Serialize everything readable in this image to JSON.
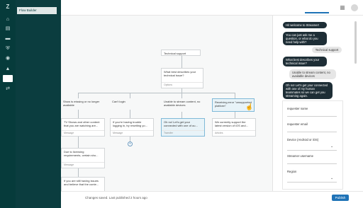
{
  "sidebar": {
    "title": "Flow Builder",
    "rail_icons": [
      "zendesk-logo-icon",
      "home-icon",
      "views-icon",
      "reporting-icon",
      "admin-icon",
      "bot-icon",
      "channels-icon",
      "flow-builder-icon",
      "switch-icon"
    ]
  },
  "topbar": {
    "icons": [
      "apps-grid-icon",
      "avatar-icon"
    ]
  },
  "canvas": {
    "nodes": {
      "technical_support": "Technical support",
      "question": "What best describes your technical issue?",
      "question_footer": "Options",
      "col1_title": "Show is missing or no longer available",
      "col1_msg": "TV Shows and other content that you are watching are...",
      "col1_footer": "Message",
      "col1_licensing": "Due to licensing requirements, certain sho...",
      "col1_licensing_footer": "Message",
      "col1_bottom": "If you are still having issues and believe that the conte...",
      "col2_title": "Can't login",
      "col2_msg": "If you're having trouble logging in, try resetting yo...",
      "col2_footer": "Message",
      "col3_title": "Unable to stream content, no available devices",
      "col3_msg": "Oh no! Let's get your connected with one of ou...",
      "col3_footer": "Transfer",
      "col4_title": "Receiving error \"unsupported platform\"",
      "col4_msg": "We currently support the latest version of iOS and...",
      "col4_footer": "Articles",
      "plus": "+"
    }
  },
  "chat": {
    "messages": [
      {
        "from": "bot",
        "text": "Hi! welcome to Streamer!"
      },
      {
        "from": "bot",
        "text": "You can just ask me a question, or what do you need help with?"
      },
      {
        "from": "user",
        "text": "Technical support"
      },
      {
        "from": "bot",
        "text": "What best describes your technical issue?"
      },
      {
        "from": "user",
        "text": "Unable to stream content, no available devices"
      },
      {
        "from": "bot",
        "text": "Oh no! Let's get your connected with one of my human teammates so we can get you streaming again."
      }
    ]
  },
  "form": {
    "fields": [
      {
        "label": "requester name",
        "has_chevron": false
      },
      {
        "label": "requester email",
        "has_chevron": false
      },
      {
        "label": "Device (Android or iOS)",
        "has_chevron": true
      },
      {
        "label": "Streamer username",
        "has_chevron": false
      },
      {
        "label": "Region",
        "has_chevron": true
      }
    ]
  },
  "bottom": {
    "status": "Changes saved. Last published 2 hours ago",
    "publish_label": "Publish"
  },
  "colors": {
    "rail": "#063b3b",
    "nav": "#0b3d3f",
    "accent": "#1f73b7",
    "bot_bubble": "#1e2e36"
  }
}
